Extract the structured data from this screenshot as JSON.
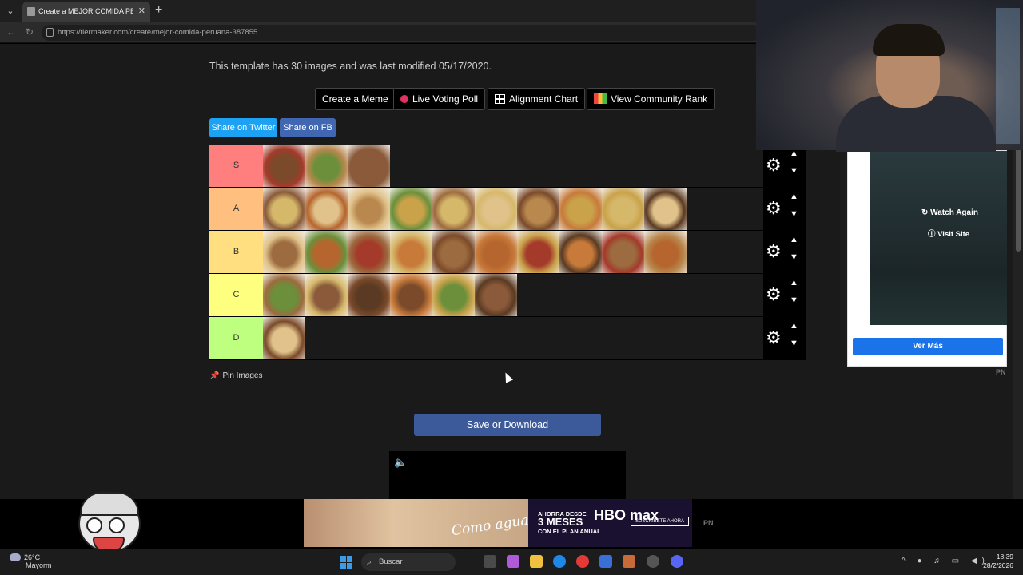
{
  "browser": {
    "tab_title": "Create a MEJOR COMIDA PERUANA",
    "url": "https://tiermaker.com/create/mejor-comida-peruana-387855"
  },
  "page": {
    "template_info": "This template has 30 images and was last modified 05/17/2020.",
    "buttons": {
      "create_meme": "Create a Meme",
      "live_poll": "Live Voting Poll",
      "alignment": "Alignment Chart",
      "community_rank": "View Community Rank"
    },
    "share": {
      "twitter": "Share on Twitter",
      "fb": "Share on FB"
    },
    "tiers": [
      {
        "label": "S",
        "color": "#ff7f7f",
        "count": 3
      },
      {
        "label": "A",
        "color": "#ffbf7f",
        "count": 10
      },
      {
        "label": "B",
        "color": "#ffdf7f",
        "count": 10
      },
      {
        "label": "C",
        "color": "#ffff7f",
        "count": 6
      },
      {
        "label": "D",
        "color": "#bfff7f",
        "count": 1
      }
    ],
    "pin_images": "Pin Images",
    "save_button": "Save or Download"
  },
  "side_ad": {
    "watch_again": "Watch Again",
    "visit_site": "Visit Site",
    "cta": "Ver Más",
    "badge": "PN"
  },
  "bottom_ad": {
    "script_text": "Como agua para Chocolate",
    "offer_line1": "AHORRA DESDE",
    "offer_line2": "3 MESES",
    "offer_line3": "CON EL PLAN ANUAL",
    "brand": "HBO max",
    "cta": "SUSCRÍBETE AHORA",
    "badge": "PN"
  },
  "taskbar": {
    "temp": "26°C",
    "weather_sub": "Mayorm",
    "search_placeholder": "Buscar",
    "time": "18:39",
    "date": "28/2/2026"
  }
}
